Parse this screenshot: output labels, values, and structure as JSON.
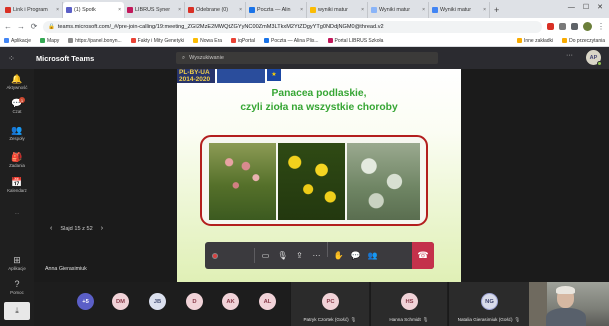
{
  "browser": {
    "tabs": [
      {
        "label": "Link i Program",
        "color": "#d93025"
      },
      {
        "label": "(1) Spotk",
        "color": "#5b5fc7"
      },
      {
        "label": "LIBRUS Syner",
        "color": "#c2185b"
      },
      {
        "label": "Odebrane (0)",
        "color": "#d93025"
      },
      {
        "label": "Poczta — Alin",
        "color": "#1a73e8"
      },
      {
        "label": "wyniki matur",
        "color": "#fbbc04"
      },
      {
        "label": "Wyniki matur",
        "color": "#8ab4f8"
      },
      {
        "label": "Wyniki matur",
        "color": "#4285f4"
      }
    ],
    "new_tab": "+",
    "window_controls": [
      "—",
      "☐",
      "✕"
    ],
    "url": "teams.microsoft.com/_#/pre-join-calling/19:meeting_ZGI2MzE2MWQtZGYyNC00ZmM3LTkxM2YtZDgyYTg0NDdjNGM0@thread.v2",
    "bookmarks": [
      {
        "label": "Aplikacje",
        "color": "#4285f4"
      },
      {
        "label": "Mapy",
        "color": "#34a853"
      },
      {
        "label": "https://panel.bonyn...",
        "color": "#888888"
      },
      {
        "label": "Fakty i Mity Genetyki",
        "color": "#ea4335"
      },
      {
        "label": "Nowa Era",
        "color": "#fbbc04"
      },
      {
        "label": "iqPortal",
        "color": "#ea4335"
      },
      {
        "label": "Poczta — Alina Plis...",
        "color": "#1a73e8"
      },
      {
        "label": "Portal LIBRUS Szkoła",
        "color": "#c2185b"
      }
    ],
    "bookmarks_right": [
      {
        "label": "Inne zakładki"
      },
      {
        "label": "Do przeczytania"
      }
    ]
  },
  "teams": {
    "brand": "Microsoft Teams",
    "search_placeholder": "Wyszukiwanie",
    "more": "···",
    "user_initials": "AP",
    "rail": [
      {
        "label": "Aktywność",
        "icon": "bell-icon",
        "glyph": "🔔"
      },
      {
        "label": "Czat",
        "icon": "chat-icon",
        "glyph": "💬",
        "badge": "1"
      },
      {
        "label": "Zespoły",
        "icon": "teams-icon",
        "glyph": "👥"
      },
      {
        "label": "Zadania",
        "icon": "assignments-icon",
        "glyph": "🎒"
      },
      {
        "label": "Kalendarz",
        "icon": "calendar-icon",
        "glyph": "📅"
      },
      {
        "label": "···",
        "icon": "more-apps-icon",
        "glyph": ""
      }
    ],
    "rail_bottom": [
      {
        "label": "Aplikacje",
        "icon": "apps-icon",
        "glyph": "⊞"
      },
      {
        "label": "Pomoc",
        "icon": "help-icon",
        "glyph": "?"
      }
    ]
  },
  "slide": {
    "logo_text": "PL-BY-UA 2014-2020",
    "title_line1": "Panacea podlaskie,",
    "title_line2": "czyli zioła na wszystkie choroby"
  },
  "call": {
    "slide_counter": "Slajd 15 z 52",
    "presenter": "Anna Gierasimiuk",
    "timer": "",
    "controls": [
      {
        "name": "camera-off-icon",
        "glyph": "▭"
      },
      {
        "name": "mic-off-icon",
        "glyph": "🎙"
      },
      {
        "name": "share-screen-icon",
        "glyph": "⇪"
      },
      {
        "name": "more-actions-icon",
        "glyph": "···"
      },
      {
        "name": "raise-hand-icon",
        "glyph": "✋"
      },
      {
        "name": "chat-bubble-icon",
        "glyph": "💬"
      },
      {
        "name": "participants-icon",
        "glyph": "👥"
      }
    ],
    "hangup_glyph": "☎",
    "accent": "#c4314b"
  },
  "participants": {
    "overflow": "+5",
    "avatars": [
      "DM",
      "JB",
      "D",
      "AK",
      "AL"
    ],
    "tiles": [
      {
        "initials": "PC",
        "name": "Patryk Czortek (Gość)"
      },
      {
        "initials": "HS",
        "name": "Hanna Schmidt"
      },
      {
        "initials": "NG",
        "name": "Natalia Gierasimiuk (Gość)"
      }
    ],
    "mic_glyph": "🎙"
  },
  "taskbar": {
    "download_glyph": "⤓"
  }
}
